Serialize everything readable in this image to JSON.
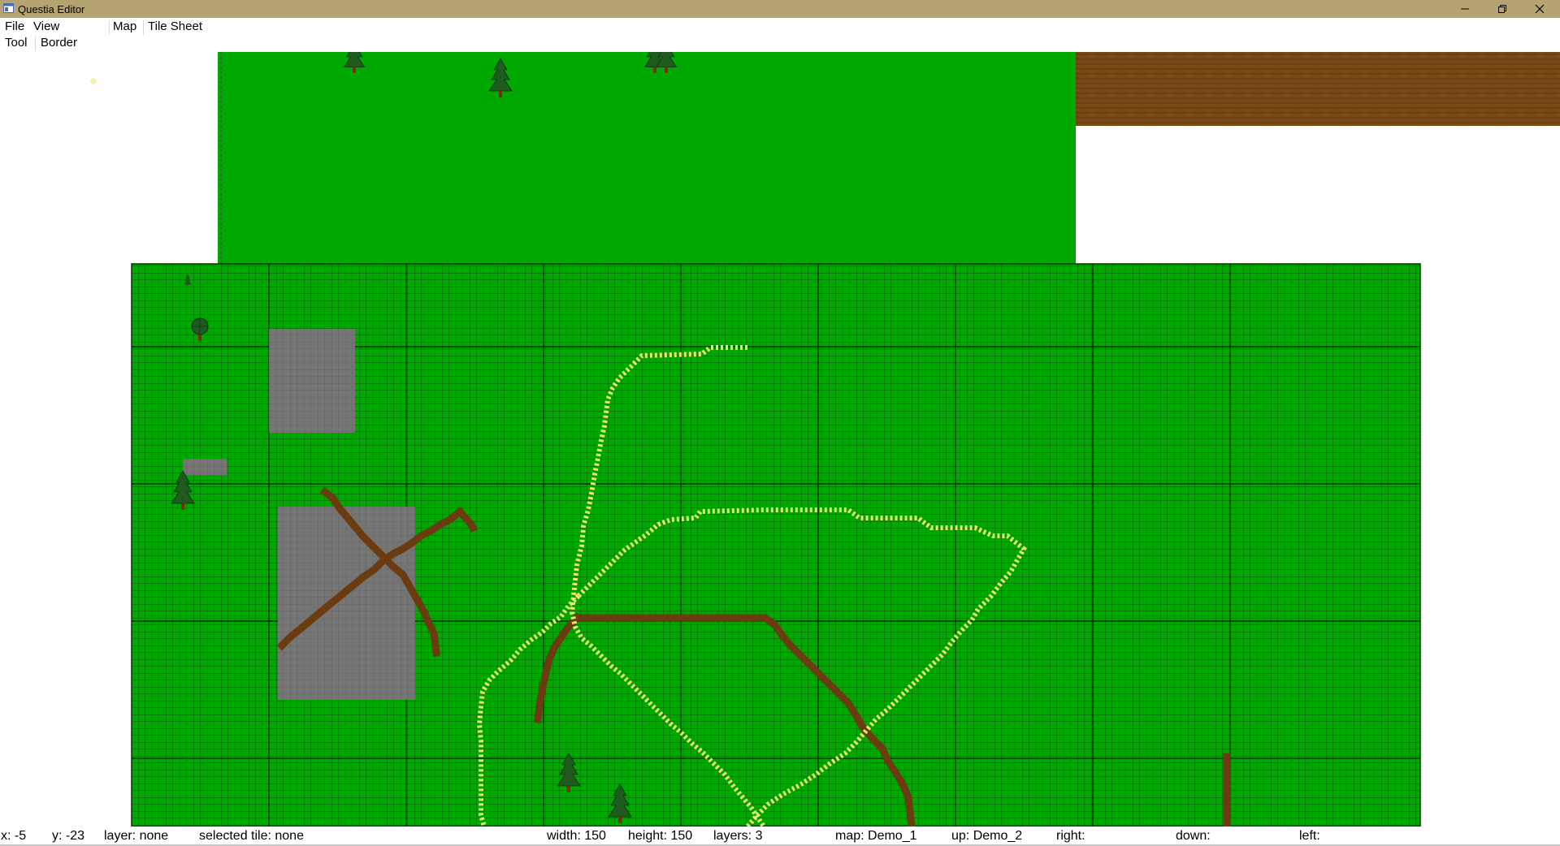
{
  "window": {
    "title": "Questia Editor",
    "icons": {
      "app": "app-window-icon",
      "minimize": "minimize-icon",
      "maximize": "restore-icon",
      "close": "close-icon"
    }
  },
  "menu": {
    "file": "File",
    "view": "View",
    "map": "Map",
    "tile_sheet": "Tile Sheet",
    "tool": "Tool",
    "border": "Border"
  },
  "status": {
    "x": "x: -5",
    "y": "y: -23",
    "layer": "layer: none",
    "selected_tile": "selected tile:  none",
    "width": "width: 150",
    "height": "height: 150",
    "layers": "layers: 3",
    "map": "map: Demo_1",
    "up": "up: Demo_2",
    "right": "right:",
    "down": "down:",
    "left": "left:"
  },
  "colors": {
    "titlebar": "#b5a472",
    "grass": "#00a900",
    "grass_grid": "#0a9e0a",
    "grid_line": "#0b3d0b",
    "stone": "#757575",
    "dirt": "#6b3c12",
    "wood": "#7a4a16",
    "flowers": "#e6e86e",
    "tree": "#1f5a1f"
  },
  "map_view": {
    "trees": [
      "pine-tree",
      "pine-tree",
      "pine-tree",
      "round-tree",
      "pine-tree",
      "pine-tree",
      "pine-tree",
      "small-sapling"
    ]
  }
}
